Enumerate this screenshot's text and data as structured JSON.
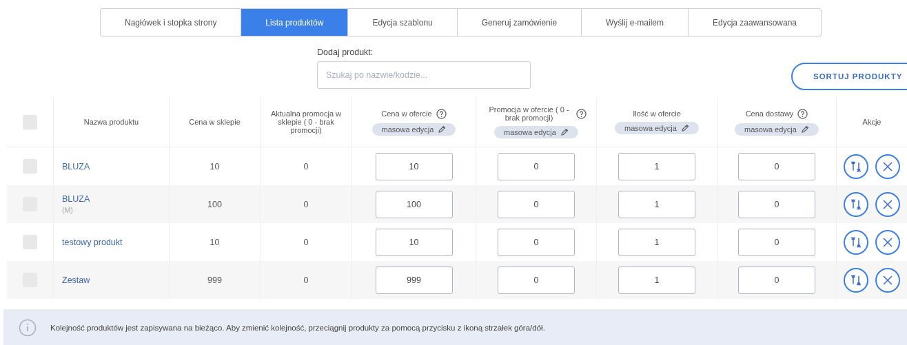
{
  "tabs": [
    {
      "label": "Nagłówek i stopka strony",
      "selected": false
    },
    {
      "label": "Lista produktów",
      "selected": true
    },
    {
      "label": "Edycja szablonu",
      "selected": false
    },
    {
      "label": "Generuj zamówienie",
      "selected": false
    },
    {
      "label": "Wyślij e-mailem",
      "selected": false
    },
    {
      "label": "Edycja zaawansowana",
      "selected": false
    }
  ],
  "search": {
    "label": "Dodaj produkt:",
    "placeholder": "Szukaj po nazwie/kodzie..."
  },
  "sort_button": "SORTUJ PRODUKTY",
  "table": {
    "select_all": {
      "checked": false
    },
    "columns": [
      {
        "label": "Nazwa produktu"
      },
      {
        "label": "Cena w sklepie"
      },
      {
        "label": "Aktualna promocja w sklepie ( 0 - brak promocji)"
      },
      {
        "label": "Cena w ofercie",
        "help": true,
        "bulk": "masowa edycja"
      },
      {
        "label": "Promocja w ofercie ( 0 - brak promocji)",
        "help": true,
        "bulk": "masowa edycja"
      },
      {
        "label": "Ilość w ofercie",
        "help": false,
        "bulk": "masowa edycja"
      },
      {
        "label": "Cena dostawy",
        "help": true,
        "bulk": "masowa edycja"
      },
      {
        "label": "Akcje"
      }
    ],
    "rows": [
      {
        "checked": false,
        "name": "BLUZA",
        "shop_price": "10",
        "shop_promo": "0",
        "offer_price": "10",
        "offer_promo": "0",
        "quantity": "1",
        "shipping": "0"
      },
      {
        "checked": false,
        "name": "BLUZA",
        "variant": "(M)",
        "shop_price": "100",
        "shop_promo": "0",
        "offer_price": "100",
        "offer_promo": "0",
        "quantity": "1",
        "shipping": "0"
      },
      {
        "checked": false,
        "name": "testowy produkt",
        "shop_price": "10",
        "shop_promo": "0",
        "offer_price": "10",
        "offer_promo": "0",
        "quantity": "1",
        "shipping": "0"
      },
      {
        "checked": false,
        "name": "Zestaw",
        "shop_price": "999",
        "shop_promo": "0",
        "offer_price": "999",
        "offer_promo": "0",
        "quantity": "1",
        "shipping": "0"
      }
    ]
  },
  "info": "Kolejność produktów jest zapisywana na bieżąco. Aby zmienić kolejność, przeciągnij produkty za pomocą przycisku z ikoną strzałek góra/dół."
}
